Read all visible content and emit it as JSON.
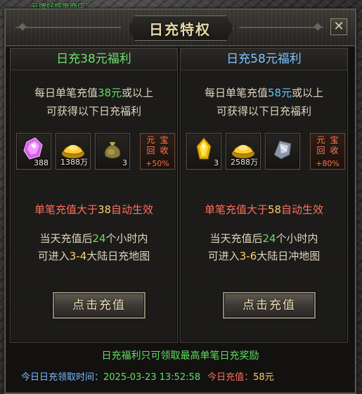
{
  "shop_label": "云牌好感度商店",
  "window": {
    "title": "日充特权",
    "close_icon": "close-x-icon"
  },
  "panels": [
    {
      "header": "日充38元福利",
      "desc_prefix": "每日单笔充值",
      "desc_amount": "38元",
      "desc_suffix": "或以上",
      "desc_line2": "可获得以下日充福利",
      "items": [
        {
          "icon": "pink-gem-icon",
          "count": "388"
        },
        {
          "icon": "gold-ingot-icon",
          "count": "1388万"
        },
        {
          "icon": "money-bag-icon",
          "count": "3"
        }
      ],
      "recycle": {
        "chars": [
          "元",
          "宝",
          "回",
          "收"
        ],
        "pct": "+50%"
      },
      "cond_prefix": "单笔充值大于",
      "cond_num": "38",
      "cond_suffix": "自动生效",
      "dur_prefix": "当天充值后",
      "dur_num": "24",
      "dur_suffix": "个小时内",
      "map_prefix": "可进入",
      "map_range": "3-4",
      "map_suffix": "大陆日充地图",
      "button": "点击充值"
    },
    {
      "header": "日充58元福利",
      "desc_prefix": "每日单笔充值",
      "desc_amount": "58元",
      "desc_suffix": "或以上",
      "desc_line2": "可获得以下日充福利",
      "items": [
        {
          "icon": "gold-crystal-icon",
          "count": "3"
        },
        {
          "icon": "gold-ingot-icon",
          "count": "2588万"
        },
        {
          "icon": "silver-ore-icon",
          "count": ""
        }
      ],
      "recycle": {
        "chars": [
          "元",
          "宝",
          "回",
          "收"
        ],
        "pct": "+80%"
      },
      "cond_prefix": "单笔充值大于",
      "cond_num": "58",
      "cond_suffix": "自动生效",
      "dur_prefix": "当天充值后",
      "dur_num": "24",
      "dur_suffix": "个小时内",
      "map_prefix": "可进入",
      "map_range": "3-6",
      "map_suffix": "大陆日冲地图",
      "button": "点击充值"
    }
  ],
  "footer": {
    "note": "日充福利只可领取最高单笔日充奖励",
    "time_label": "今日日充领取时间：",
    "time_value": "2025-03-23 13:52:58",
    "recharge_label": "今日充值：",
    "recharge_value": "58元"
  },
  "colors": {
    "green": "#62e062",
    "blue": "#7fc4ff",
    "red": "#ff6e5c",
    "gold": "#ffcf6a"
  }
}
